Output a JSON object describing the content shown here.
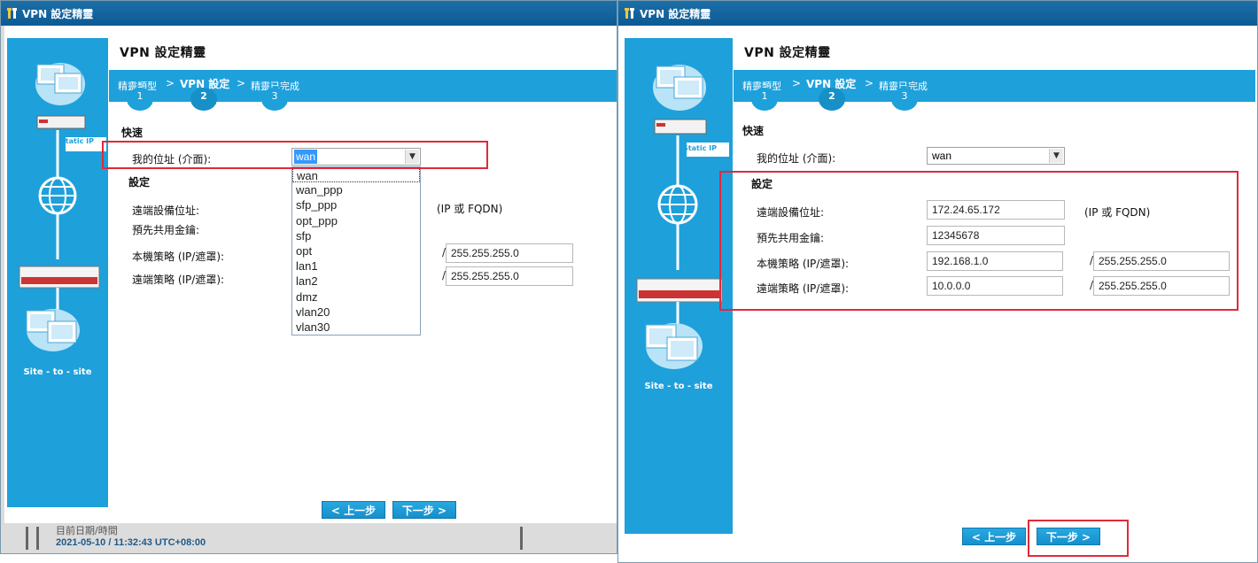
{
  "window_title": "VPN 設定精靈",
  "page_title": "VPN 設定精靈",
  "sidebar": {
    "static_ip_label": "Static IP",
    "site_label": "Site - to - site"
  },
  "steps": [
    {
      "label": "精靈類型",
      "num": "1"
    },
    {
      "label": "VPN 設定",
      "num": "2"
    },
    {
      "label": "精靈已完成",
      "num": "3"
    }
  ],
  "quick_section": "快速",
  "my_address_label": "我的位址 (介面):",
  "settings_section": "設定",
  "remote_gateway_label": "遠端設備位址:",
  "psk_label": "預先共用金鑰:",
  "local_policy_label": "本機策略 (IP/遮罩):",
  "remote_policy_label": "遠端策略 (IP/遮罩):",
  "ip_hint": "(IP 或 FQDN)",
  "slash": "/",
  "left": {
    "interface_value": "wan",
    "interface_options": [
      "wan",
      "wan_ppp",
      "sfp_ppp",
      "opt_ppp",
      "sfp",
      "opt",
      "lan1",
      "lan2",
      "dmz",
      "vlan20",
      "vlan30"
    ],
    "local_mask": "255.255.255.0",
    "remote_mask": "255.255.255.0",
    "footer_label": "目前日期/時間",
    "footer_time": "2021-05-10 / 11:32:43 UTC+08:00"
  },
  "right": {
    "interface_value": "wan",
    "remote_gateway": "172.24.65.172",
    "psk": "12345678",
    "local_ip": "192.168.1.0",
    "local_mask": "255.255.255.0",
    "remote_ip": "10.0.0.0",
    "remote_mask": "255.255.255.0"
  },
  "buttons": {
    "prev": "< 上一步",
    "next": "下一步 >"
  },
  "colors": {
    "title_bar": "#0c5a94",
    "accent": "#1ea0db",
    "highlight_box": "#e02a3a"
  }
}
